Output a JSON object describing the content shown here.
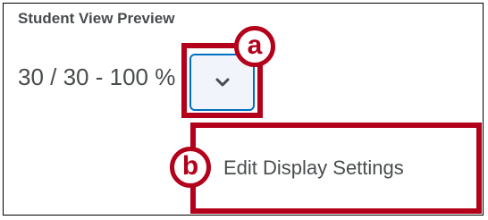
{
  "panel": {
    "title": "Student View Preview",
    "grade_display": "30 / 30 - 100 %"
  },
  "dropdown": {
    "icon": "chevron-down-icon"
  },
  "menu": {
    "items": [
      {
        "label": "Edit Display Settings"
      }
    ]
  },
  "annotations": {
    "badge_a": "a",
    "badge_b": "b",
    "highlight_color": "#b3001b"
  },
  "colors": {
    "text": "#494c4e",
    "button_border": "#006fbf",
    "button_background": "#f1f5fb"
  }
}
